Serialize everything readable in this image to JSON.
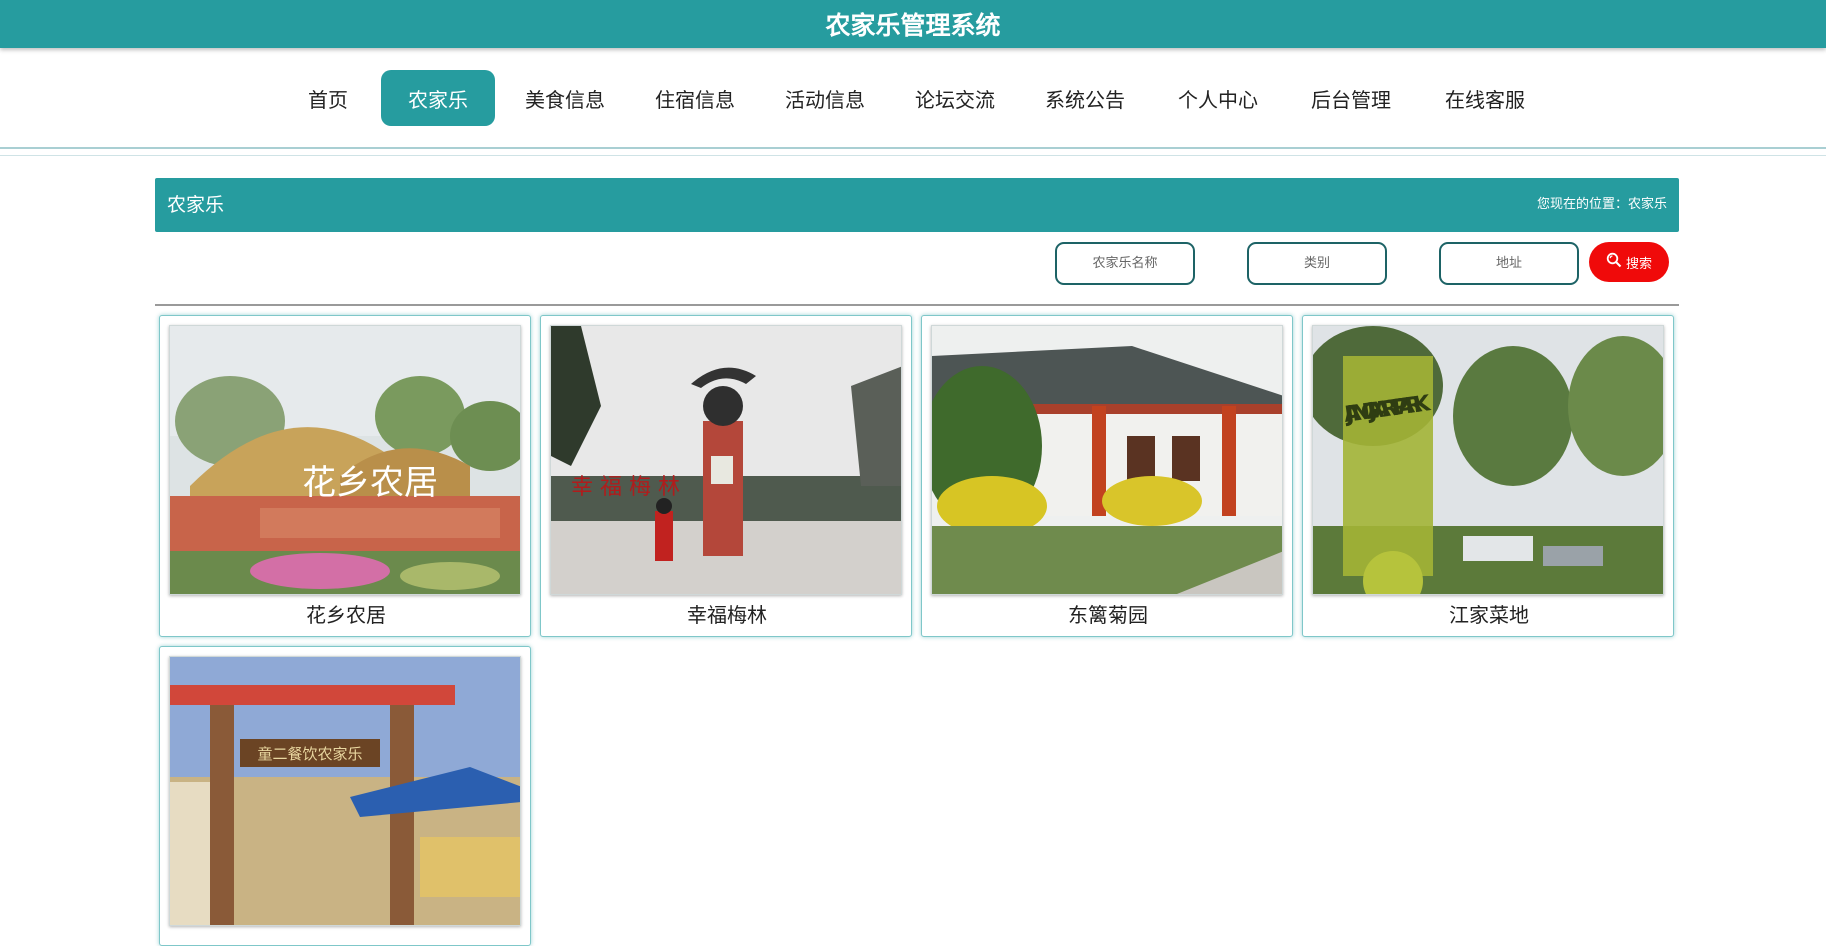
{
  "app": {
    "title": "农家乐管理系统"
  },
  "nav": {
    "items": [
      {
        "label": "首页"
      },
      {
        "label": "农家乐",
        "active": true
      },
      {
        "label": "美食信息"
      },
      {
        "label": "住宿信息"
      },
      {
        "label": "活动信息"
      },
      {
        "label": "论坛交流"
      },
      {
        "label": "系统公告"
      },
      {
        "label": "个人中心"
      },
      {
        "label": "后台管理"
      },
      {
        "label": "在线客服"
      }
    ]
  },
  "section": {
    "title": "农家乐",
    "breadcrumb_prefix": "您现在的位置：",
    "breadcrumb_current": "农家乐"
  },
  "filters": {
    "name_placeholder": "农家乐名称",
    "category_placeholder": "类别",
    "address_placeholder": "地址",
    "search_label": "搜索"
  },
  "cards": [
    {
      "name": "花乡农居",
      "sign_text": "花乡农居"
    },
    {
      "name": "幸福梅林",
      "sign_text": "幸 福 梅 林"
    },
    {
      "name": "东篱菊园",
      "sign_text": ""
    },
    {
      "name": "江家菜地",
      "sign_text": "JIANG JIA ART PARK"
    },
    {
      "name": "",
      "sign_text": "童二餐饮农家乐"
    }
  ],
  "colors": {
    "primary": "#269c9f",
    "search_button": "#f00a0a",
    "input_border": "#1d6366"
  },
  "icons": {
    "search": "magnifier-icon"
  }
}
